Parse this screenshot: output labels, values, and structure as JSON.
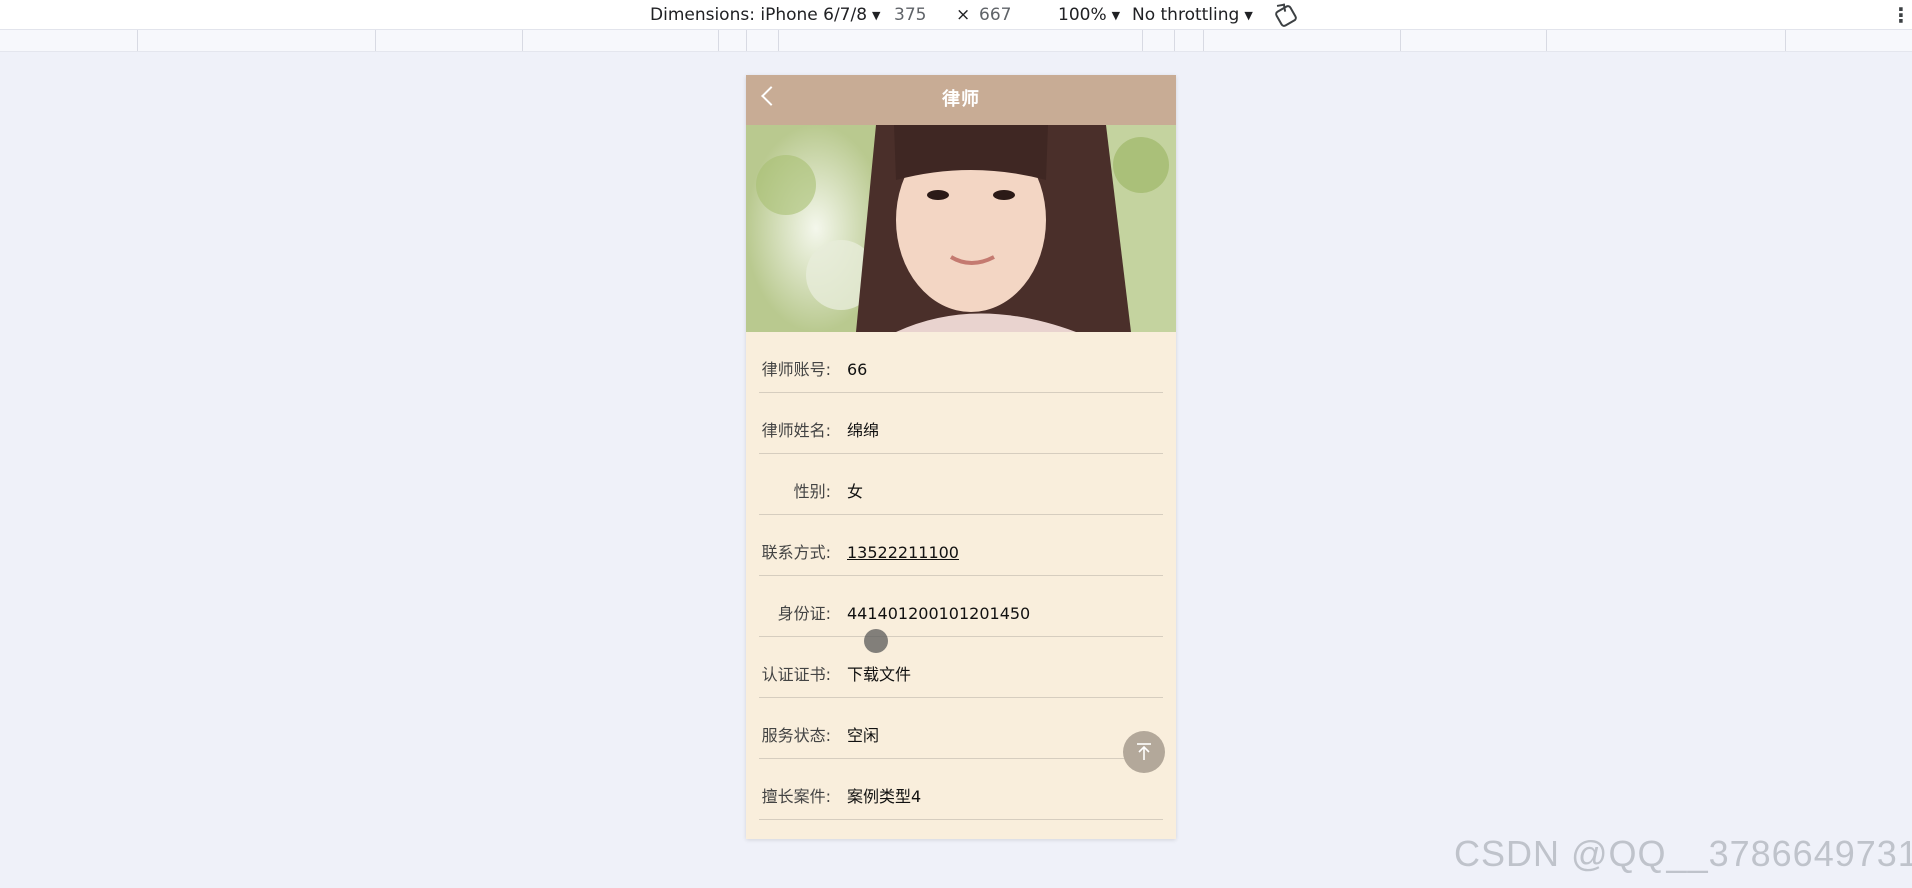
{
  "devtools": {
    "device_label": "Dimensions: iPhone 6/7/8",
    "width": "375",
    "times": "×",
    "height": "667",
    "zoom": "100%",
    "throttling": "No throttling",
    "rotate_icon": "rotate-icon",
    "menu_icon": "kebab-menu-icon"
  },
  "header": {
    "title": "律师",
    "back_icon": "chevron-left-icon",
    "bg_color": "#c8ac95"
  },
  "profile": {
    "fields": [
      {
        "label": "律师账号:",
        "value": "66"
      },
      {
        "label": "律师姓名:",
        "value": "绵绵"
      },
      {
        "label": "性别:",
        "value": "女"
      },
      {
        "label": "联系方式:",
        "value": "13522211100"
      },
      {
        "label": "身份证:",
        "value": "441401200101201450"
      },
      {
        "label": "认证证书:",
        "value": "下载文件"
      },
      {
        "label": "服务状态:",
        "value": "空闲"
      },
      {
        "label": "擅长案件:",
        "value": "案例类型4"
      }
    ]
  },
  "back_to_top_icon": "arrow-up-to-top-icon",
  "watermark": "CSDN @QQ__3786649731"
}
